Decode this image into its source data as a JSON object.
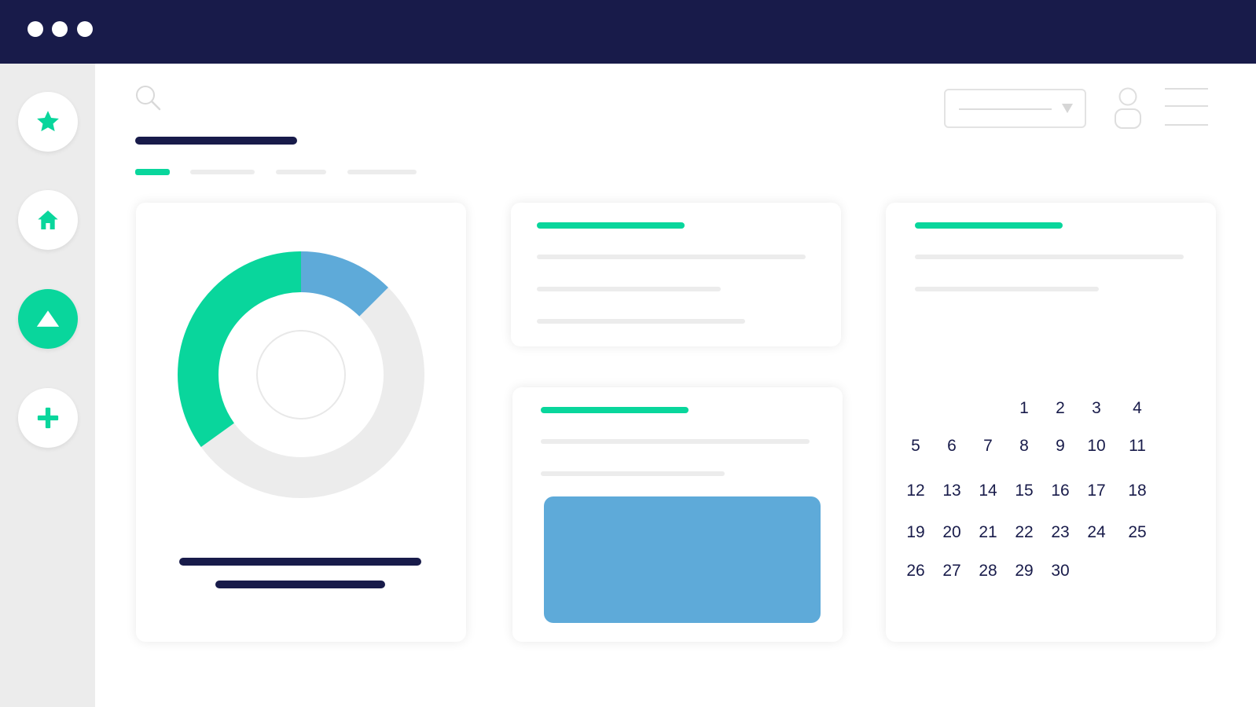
{
  "window": {
    "controls": [
      "window-dot",
      "window-dot",
      "window-dot"
    ]
  },
  "sidebar": {
    "items": [
      {
        "name": "favorites",
        "icon": "star-icon",
        "active": false
      },
      {
        "name": "home",
        "icon": "home-icon",
        "active": true,
        "note": "white-bg"
      },
      {
        "name": "upload",
        "icon": "triangle-up-icon",
        "active": true
      },
      {
        "name": "add",
        "icon": "plus-icon",
        "active": false
      }
    ]
  },
  "colors": {
    "navy": "#181b4a",
    "accent": "#09d69c",
    "blue": "#5eaad9",
    "track": "#ececec"
  },
  "header": {
    "search_icon": "search-icon",
    "user_icon": "user-icon",
    "menu_icon": "menu-icon",
    "dropdown_icon": "chevron-down-icon"
  },
  "tabs": [
    {
      "active": true
    },
    {
      "active": false
    },
    {
      "active": false
    },
    {
      "active": false
    }
  ],
  "donut": {
    "segments": [
      {
        "color": "#5eaad9",
        "fraction": 0.125
      },
      {
        "color": "#ececec",
        "fraction": 0.525
      },
      {
        "color": "#09d69c",
        "fraction": 0.35
      }
    ]
  },
  "calendar": {
    "weeks": [
      [
        "",
        "",
        "",
        "1",
        "2",
        "3",
        "4"
      ],
      [
        "5",
        "6",
        "7",
        "8",
        "9",
        "10",
        "11"
      ],
      [
        "12",
        "13",
        "14",
        "15",
        "16",
        "17",
        "18"
      ],
      [
        "19",
        "20",
        "21",
        "22",
        "23",
        "24",
        "25"
      ],
      [
        "26",
        "27",
        "28",
        "29",
        "30",
        "",
        ""
      ]
    ]
  }
}
